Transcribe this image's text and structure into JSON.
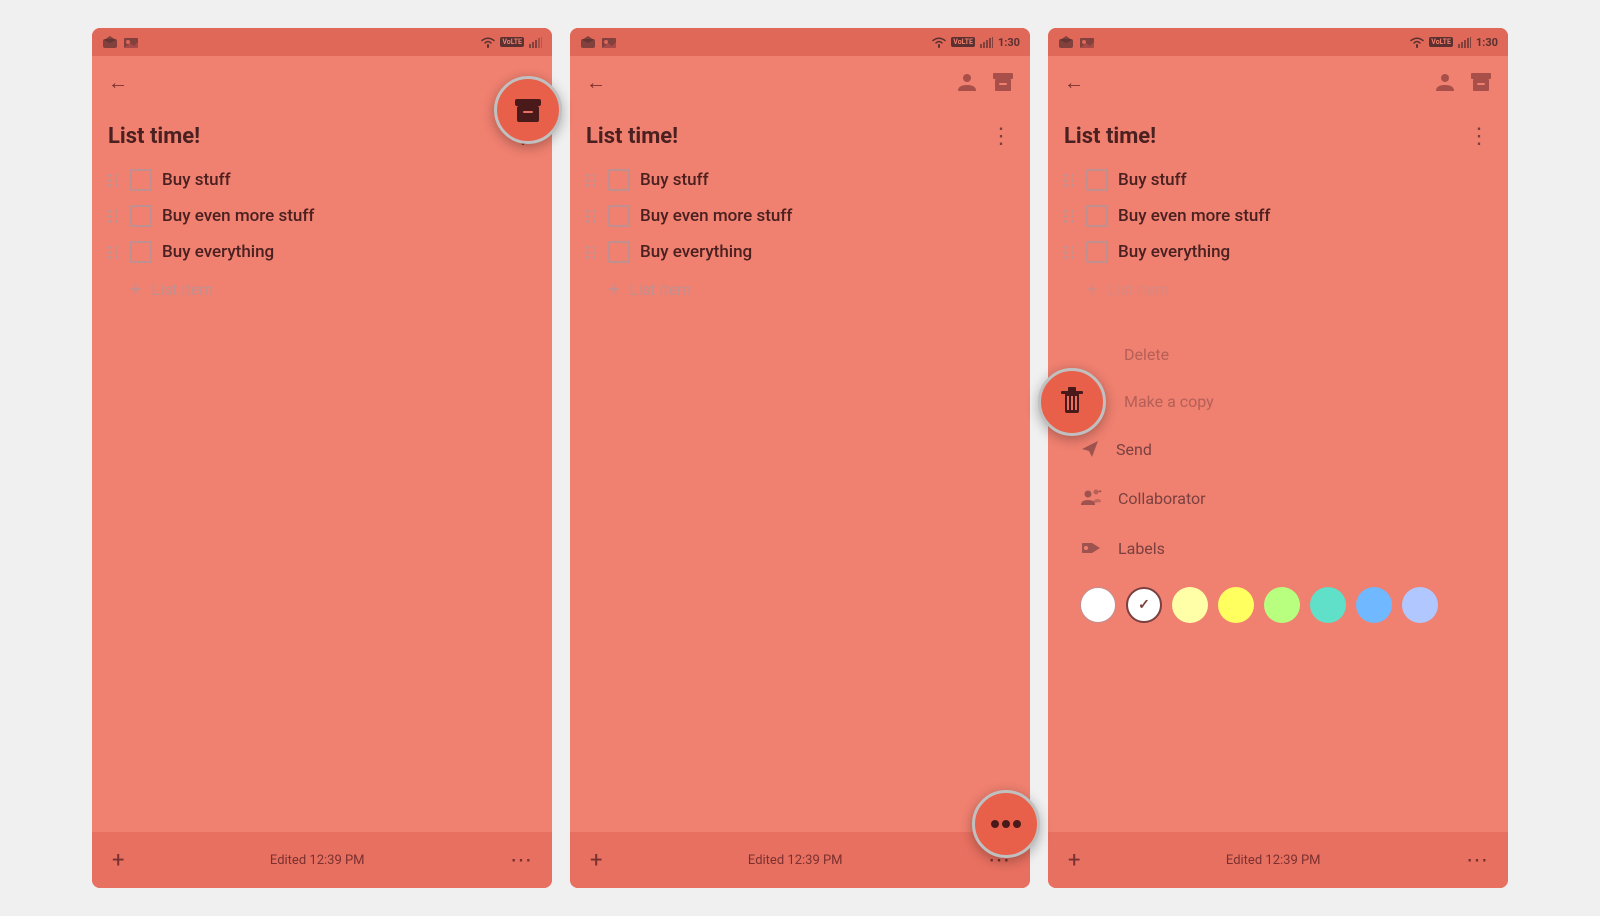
{
  "phones": [
    {
      "id": "phone1",
      "statusBar": {
        "time": "",
        "showDropbox": true,
        "showImage": true
      },
      "nav": {
        "backIcon": "←",
        "rightIcons": [
          "archive-down"
        ]
      },
      "note": {
        "title": "List time!",
        "items": [
          {
            "text": "Buy stuff"
          },
          {
            "text": "Buy even more stuff"
          },
          {
            "text": "Buy everything"
          }
        ],
        "addPlaceholder": "List item"
      },
      "fab": {
        "type": "archive",
        "icon": "⬇"
      },
      "bottomBar": {
        "editedText": "Edited 12:39 PM"
      }
    },
    {
      "id": "phone2",
      "statusBar": {
        "time": "1:30",
        "showDropbox": true,
        "showImage": true
      },
      "nav": {
        "backIcon": "←",
        "rightIcons": [
          "person",
          "archive"
        ]
      },
      "note": {
        "title": "List time!",
        "items": [
          {
            "text": "Buy stuff"
          },
          {
            "text": "Buy even more stuff"
          },
          {
            "text": "Buy everything"
          }
        ],
        "addPlaceholder": "List item"
      },
      "fab": {
        "type": "menu",
        "icon": "⋯"
      },
      "bottomBar": {
        "editedText": "Edited 12:39 PM"
      }
    },
    {
      "id": "phone3",
      "statusBar": {
        "time": "1:30",
        "showDropbox": true,
        "showImage": true
      },
      "nav": {
        "backIcon": "←",
        "rightIcons": [
          "person",
          "archive"
        ]
      },
      "note": {
        "title": "List time!",
        "items": [
          {
            "text": "Buy stuff"
          },
          {
            "text": "Buy even more stuff"
          },
          {
            "text": "Buy everything"
          }
        ],
        "addPlaceholder": "List item"
      },
      "fab": {
        "type": "delete",
        "icon": "🗑"
      },
      "contextMenu": {
        "items": [
          {
            "icon": "delete",
            "label": "Delete"
          },
          {
            "icon": "copy",
            "label": "Make a copy"
          },
          {
            "icon": "send",
            "label": "Send"
          },
          {
            "icon": "collaborator",
            "label": "Collaborator"
          },
          {
            "icon": "label",
            "label": "Labels"
          }
        ],
        "colors": [
          "#ffffff",
          "#ffffff",
          "#ffffa0",
          "#ffff80",
          "#c8ff80",
          "#80e8d0",
          "#80c8ff",
          "#c0d8ff"
        ]
      },
      "bottomBar": {
        "editedText": "Edited 12:39 PM"
      }
    }
  ],
  "labels": {
    "listItem": "List item",
    "editedPrefix": "Edited"
  }
}
